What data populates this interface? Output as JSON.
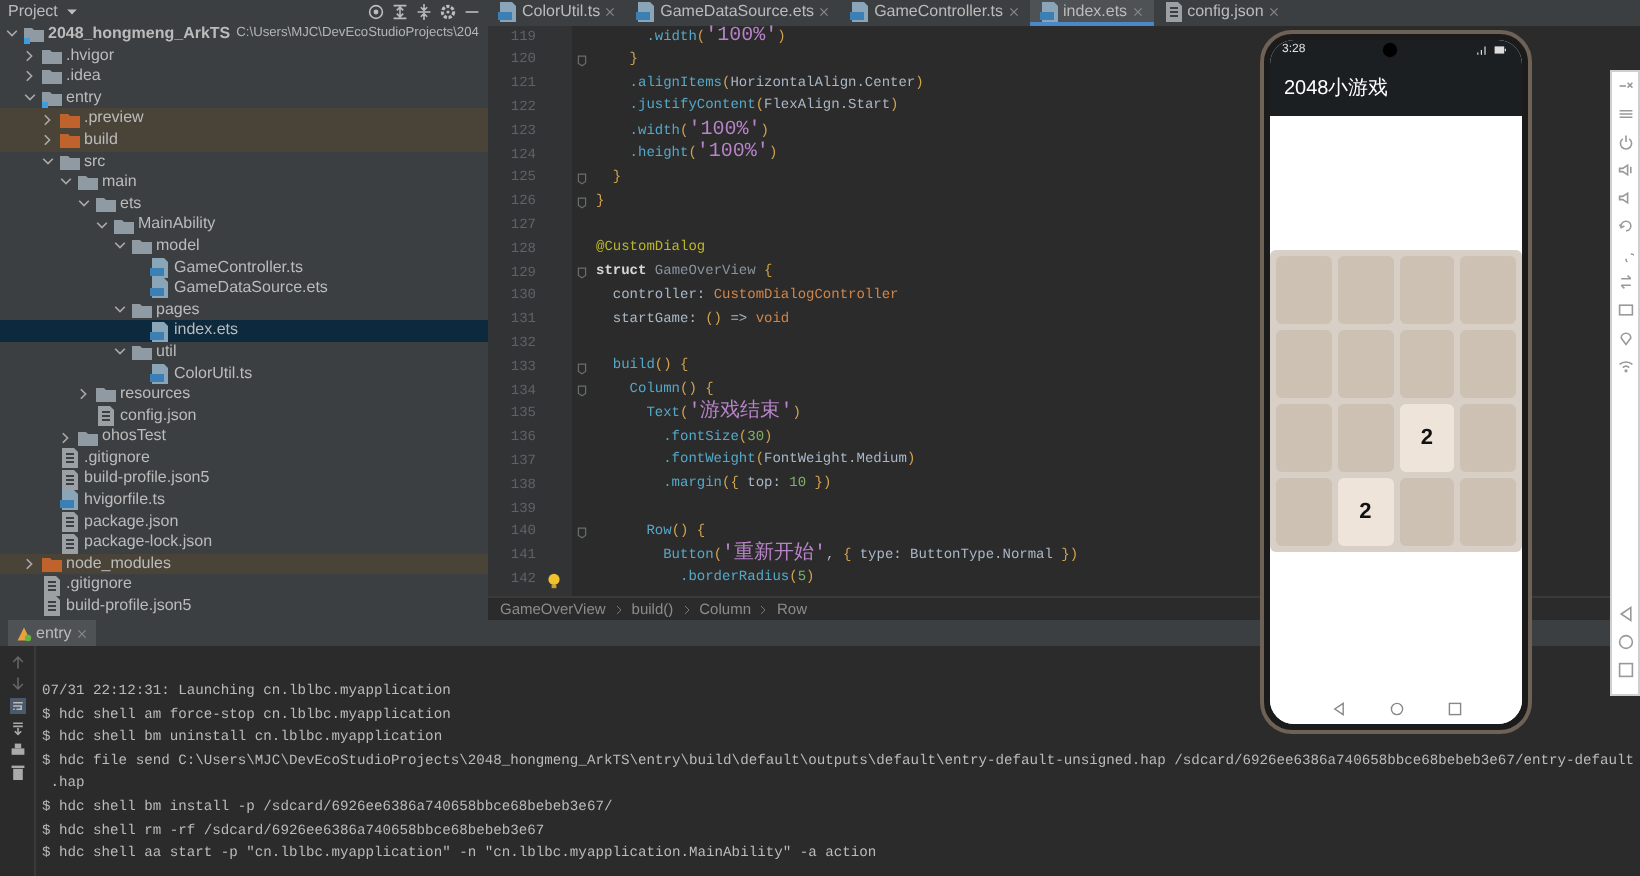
{
  "project_panel": {
    "title": "Project",
    "tree": [
      {
        "label": "2048_hongmeng_ArkTS",
        "path": "C:\\Users\\MJC\\DevEcoStudioProjects\\204",
        "kind": "module",
        "expanded": true,
        "selected": false,
        "excluded": false,
        "children": [
          {
            "label": ".hvigor",
            "kind": "folder",
            "expanded": false,
            "selected": false,
            "excluded": false
          },
          {
            "label": ".idea",
            "kind": "folder",
            "expanded": false,
            "selected": false,
            "excluded": false
          },
          {
            "label": "entry",
            "kind": "module",
            "expanded": true,
            "selected": false,
            "excluded": false,
            "children": [
              {
                "label": ".preview",
                "kind": "folder",
                "expanded": false,
                "selected": false,
                "excluded": true
              },
              {
                "label": "build",
                "kind": "folder",
                "expanded": false,
                "selected": false,
                "excluded": true
              },
              {
                "label": "src",
                "kind": "folder",
                "expanded": true,
                "selected": false,
                "excluded": false,
                "children": [
                  {
                    "label": "main",
                    "kind": "folder",
                    "expanded": true,
                    "selected": false,
                    "excluded": false,
                    "children": [
                      {
                        "label": "ets",
                        "kind": "folder",
                        "expanded": true,
                        "selected": false,
                        "excluded": false,
                        "children": [
                          {
                            "label": "MainAbility",
                            "kind": "folder",
                            "expanded": true,
                            "selected": false,
                            "excluded": false,
                            "children": [
                              {
                                "label": "model",
                                "kind": "folder",
                                "expanded": true,
                                "selected": false,
                                "excluded": false,
                                "children": [
                                  {
                                    "label": "GameController.ts",
                                    "kind": "ts_file",
                                    "selected": false
                                  },
                                  {
                                    "label": "GameDataSource.ets",
                                    "kind": "ts_file",
                                    "selected": false
                                  }
                                ]
                              },
                              {
                                "label": "pages",
                                "kind": "folder",
                                "expanded": true,
                                "selected": false,
                                "excluded": false,
                                "children": [
                                  {
                                    "label": "index.ets",
                                    "kind": "ts_file",
                                    "selected": true
                                  }
                                ]
                              },
                              {
                                "label": "util",
                                "kind": "folder",
                                "expanded": true,
                                "selected": false,
                                "excluded": false,
                                "children": [
                                  {
                                    "label": "ColorUtil.ts",
                                    "kind": "ts_file",
                                    "selected": false
                                  }
                                ]
                              }
                            ]
                          }
                        ]
                      },
                      {
                        "label": "resources",
                        "kind": "folder",
                        "expanded": false,
                        "selected": false,
                        "excluded": false
                      },
                      {
                        "label": "config.json",
                        "kind": "json_file",
                        "selected": false
                      }
                    ]
                  },
                  {
                    "label": "ohosTest",
                    "kind": "folder",
                    "expanded": false,
                    "selected": false,
                    "excluded": false
                  }
                ]
              },
              {
                "label": ".gitignore",
                "kind": "json_file",
                "selected": false
              },
              {
                "label": "build-profile.json5",
                "kind": "json_file",
                "selected": false
              },
              {
                "label": "hvigorfile.ts",
                "kind": "ts_file",
                "selected": false
              },
              {
                "label": "package.json",
                "kind": "json_file",
                "selected": false
              },
              {
                "label": "package-lock.json",
                "kind": "json_file",
                "selected": false
              }
            ]
          },
          {
            "label": "node_modules",
            "kind": "folder",
            "expanded": false,
            "selected": false,
            "excluded": true
          },
          {
            "label": ".gitignore",
            "kind": "json_file",
            "selected": false
          },
          {
            "label": "build-profile.json5",
            "kind": "json_file",
            "selected": false
          }
        ]
      }
    ]
  },
  "editor": {
    "tabs": [
      {
        "label": "ColorUtil.ts",
        "kind": "ts_file",
        "selected": false
      },
      {
        "label": "GameDataSource.ets",
        "kind": "ts_file",
        "selected": false
      },
      {
        "label": "GameController.ts",
        "kind": "ts_file",
        "selected": false
      },
      {
        "label": "index.ets",
        "kind": "ts_file",
        "selected": true
      },
      {
        "label": "config.json",
        "kind": "json_file",
        "selected": false
      }
    ],
    "lines": [
      {
        "number": "119",
        "tokens": [
          {
            "text": "      .width",
            "kind": "method"
          },
          {
            "text": "(",
            "kind": "punct"
          },
          {
            "text": "'100%'",
            "kind": "string"
          },
          {
            "text": ")",
            "kind": "punct"
          }
        ]
      },
      {
        "number": "120",
        "fold": true,
        "tokens": [
          {
            "text": "    }",
            "kind": "punct"
          }
        ]
      },
      {
        "number": "121",
        "tokens": [
          {
            "text": "    .alignItems",
            "kind": "method"
          },
          {
            "text": "(",
            "kind": "punct"
          },
          {
            "text": "HorizontalAlign.Center",
            "kind": "plain"
          },
          {
            "text": ")",
            "kind": "punct"
          }
        ]
      },
      {
        "number": "122",
        "tokens": [
          {
            "text": "    .justifyContent",
            "kind": "method"
          },
          {
            "text": "(",
            "kind": "punct"
          },
          {
            "text": "FlexAlign.Start",
            "kind": "plain"
          },
          {
            "text": ")",
            "kind": "punct"
          }
        ]
      },
      {
        "number": "123",
        "tokens": [
          {
            "text": "    .width",
            "kind": "method"
          },
          {
            "text": "(",
            "kind": "punct"
          },
          {
            "text": "'100%'",
            "kind": "string"
          },
          {
            "text": ")",
            "kind": "punct"
          }
        ]
      },
      {
        "number": "124",
        "tokens": [
          {
            "text": "    .height",
            "kind": "method"
          },
          {
            "text": "(",
            "kind": "punct"
          },
          {
            "text": "'100%'",
            "kind": "string"
          },
          {
            "text": ")",
            "kind": "punct"
          }
        ]
      },
      {
        "number": "125",
        "fold": true,
        "tokens": [
          {
            "text": "  }",
            "kind": "punct"
          }
        ]
      },
      {
        "number": "126",
        "fold": true,
        "tokens": [
          {
            "text": "}",
            "kind": "punct"
          }
        ]
      },
      {
        "number": "127"
      },
      {
        "number": "128",
        "tokens": [
          {
            "text": "@CustomDialog",
            "kind": "decorator"
          }
        ]
      },
      {
        "number": "129",
        "fold": true,
        "tokens": [
          {
            "text": "struct",
            "kind": "keyword"
          },
          {
            "text": " GameOverView ",
            "kind": "name"
          },
          {
            "text": "{",
            "kind": "punct"
          }
        ]
      },
      {
        "number": "130",
        "tokens": [
          {
            "text": "  controller: ",
            "kind": "plain"
          },
          {
            "text": "CustomDialogController",
            "kind": "type"
          }
        ]
      },
      {
        "number": "131",
        "tokens": [
          {
            "text": "  startGame: ",
            "kind": "plain"
          },
          {
            "text": "()",
            "kind": "punct"
          },
          {
            "text": " => ",
            "kind": "plain"
          },
          {
            "text": "void",
            "kind": "type"
          }
        ]
      },
      {
        "number": "132"
      },
      {
        "number": "133",
        "fold": true,
        "tokens": [
          {
            "text": "  build",
            "kind": "method"
          },
          {
            "text": "() {",
            "kind": "punct"
          }
        ]
      },
      {
        "number": "134",
        "fold": true,
        "tokens": [
          {
            "text": "    Column",
            "kind": "method"
          },
          {
            "text": "() {",
            "kind": "punct"
          }
        ]
      },
      {
        "number": "135",
        "tokens": [
          {
            "text": "      Text",
            "kind": "method"
          },
          {
            "text": "(",
            "kind": "punct"
          },
          {
            "text": "'游戏结束'",
            "kind": "string"
          },
          {
            "text": ")",
            "kind": "punct"
          }
        ]
      },
      {
        "number": "136",
        "tokens": [
          {
            "text": "        .fontSize",
            "kind": "method"
          },
          {
            "text": "(",
            "kind": "punct"
          },
          {
            "text": "30",
            "kind": "number"
          },
          {
            "text": ")",
            "kind": "punct"
          }
        ]
      },
      {
        "number": "137",
        "tokens": [
          {
            "text": "        .fontWeight",
            "kind": "method"
          },
          {
            "text": "(",
            "kind": "punct"
          },
          {
            "text": "FontWeight.Medium",
            "kind": "plain"
          },
          {
            "text": ")",
            "kind": "punct"
          }
        ]
      },
      {
        "number": "138",
        "tokens": [
          {
            "text": "        .margin",
            "kind": "method"
          },
          {
            "text": "({",
            "kind": "punct"
          },
          {
            "text": " top: ",
            "kind": "plain"
          },
          {
            "text": "10",
            "kind": "number"
          },
          {
            "text": " })",
            "kind": "punct"
          }
        ]
      },
      {
        "number": "139"
      },
      {
        "number": "140",
        "fold": true,
        "tokens": [
          {
            "text": "      Row",
            "kind": "method"
          },
          {
            "text": "() {",
            "kind": "punct"
          }
        ]
      },
      {
        "number": "141",
        "tokens": [
          {
            "text": "        Button",
            "kind": "method"
          },
          {
            "text": "(",
            "kind": "punct"
          },
          {
            "text": "'重新开始'",
            "kind": "string"
          },
          {
            "text": ", ",
            "kind": "plain"
          },
          {
            "text": "{",
            "kind": "punct"
          },
          {
            "text": " type: ButtonType.Normal ",
            "kind": "plain"
          },
          {
            "text": "})",
            "kind": "punct"
          }
        ]
      },
      {
        "number": "142",
        "bulb": true,
        "tokens": [
          {
            "text": "          .borderRadius",
            "kind": "method"
          },
          {
            "text": "(",
            "kind": "punct"
          },
          {
            "text": "5",
            "kind": "number"
          },
          {
            "text": ")",
            "kind": "punct"
          }
        ]
      }
    ],
    "breadcrumbs": [
      "GameOverView",
      "build()",
      "Column",
      "Row"
    ]
  },
  "run_panel": {
    "tab": "entry",
    "lines": [
      "07/31 22:12:31: Launching cn.lblbc.myapplication",
      "$ hdc shell am force-stop cn.lblbc.myapplication",
      "$ hdc shell bm uninstall cn.lblbc.myapplication",
      "$ hdc file send C:\\Users\\MJC\\DevEcoStudioProjects\\2048_hongmeng_ArkTS\\entry\\build\\default\\outputs\\default\\entry-default-unsigned.hap /sdcard/6926ee6386a740658bbce68bebeb3e67/entry-default",
      " .hap",
      "$ hdc shell bm install -p /sdcard/6926ee6386a740658bbce68bebeb3e67/",
      "$ hdc shell rm -rf /sdcard/6926ee6386a740658bbce68bebeb3e67",
      "$ hdc shell aa start -p \"cn.lblbc.myapplication\" -n \"cn.lblbc.myapplication.MainAbility\" -a action"
    ]
  },
  "previewer": {
    "time": "3:28",
    "app_title": "2048小游戏",
    "grid": [
      [
        {
          "kind": "empty"
        },
        {
          "kind": "empty"
        },
        {
          "kind": "empty"
        },
        {
          "kind": "empty"
        }
      ],
      [
        {
          "kind": "empty"
        },
        {
          "kind": "empty"
        },
        {
          "kind": "empty"
        },
        {
          "kind": "empty"
        }
      ],
      [
        {
          "kind": "empty"
        },
        {
          "kind": "empty"
        },
        {
          "kind": "tile",
          "value": "2"
        },
        {
          "kind": "empty"
        }
      ],
      [
        {
          "kind": "empty"
        },
        {
          "kind": "tile",
          "value": "2"
        },
        {
          "kind": "empty"
        },
        {
          "kind": "empty"
        }
      ]
    ]
  }
}
